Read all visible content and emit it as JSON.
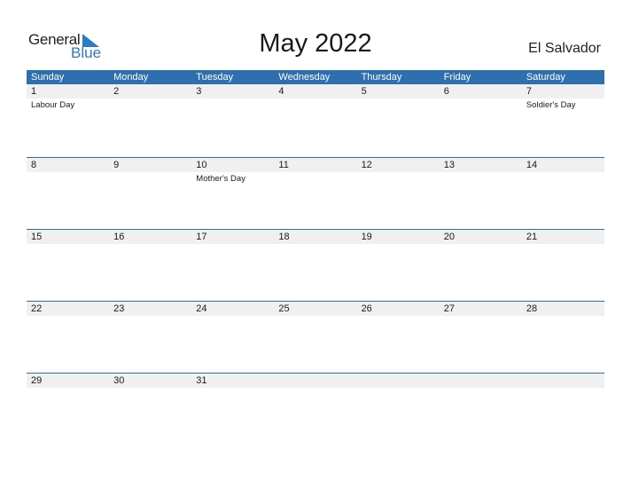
{
  "brand": {
    "name_part1": "General",
    "name_part2": "Blue",
    "accent": "#2a7bc9"
  },
  "header": {
    "title": "May 2022",
    "region": "El Salvador"
  },
  "calendar": {
    "header_color": "#2e6fb0",
    "days": [
      "Sunday",
      "Monday",
      "Tuesday",
      "Wednesday",
      "Thursday",
      "Friday",
      "Saturday"
    ],
    "weeks": [
      [
        {
          "d": "1",
          "ev": "Labour Day"
        },
        {
          "d": "2",
          "ev": ""
        },
        {
          "d": "3",
          "ev": ""
        },
        {
          "d": "4",
          "ev": ""
        },
        {
          "d": "5",
          "ev": ""
        },
        {
          "d": "6",
          "ev": ""
        },
        {
          "d": "7",
          "ev": "Soldier's Day"
        }
      ],
      [
        {
          "d": "8",
          "ev": ""
        },
        {
          "d": "9",
          "ev": ""
        },
        {
          "d": "10",
          "ev": "Mother's Day"
        },
        {
          "d": "11",
          "ev": ""
        },
        {
          "d": "12",
          "ev": ""
        },
        {
          "d": "13",
          "ev": ""
        },
        {
          "d": "14",
          "ev": ""
        }
      ],
      [
        {
          "d": "15",
          "ev": ""
        },
        {
          "d": "16",
          "ev": ""
        },
        {
          "d": "17",
          "ev": ""
        },
        {
          "d": "18",
          "ev": ""
        },
        {
          "d": "19",
          "ev": ""
        },
        {
          "d": "20",
          "ev": ""
        },
        {
          "d": "21",
          "ev": ""
        }
      ],
      [
        {
          "d": "22",
          "ev": ""
        },
        {
          "d": "23",
          "ev": ""
        },
        {
          "d": "24",
          "ev": ""
        },
        {
          "d": "25",
          "ev": ""
        },
        {
          "d": "26",
          "ev": ""
        },
        {
          "d": "27",
          "ev": ""
        },
        {
          "d": "28",
          "ev": ""
        }
      ],
      [
        {
          "d": "29",
          "ev": ""
        },
        {
          "d": "30",
          "ev": ""
        },
        {
          "d": "31",
          "ev": ""
        },
        {
          "d": "",
          "ev": ""
        },
        {
          "d": "",
          "ev": ""
        },
        {
          "d": "",
          "ev": ""
        },
        {
          "d": "",
          "ev": ""
        }
      ]
    ]
  }
}
